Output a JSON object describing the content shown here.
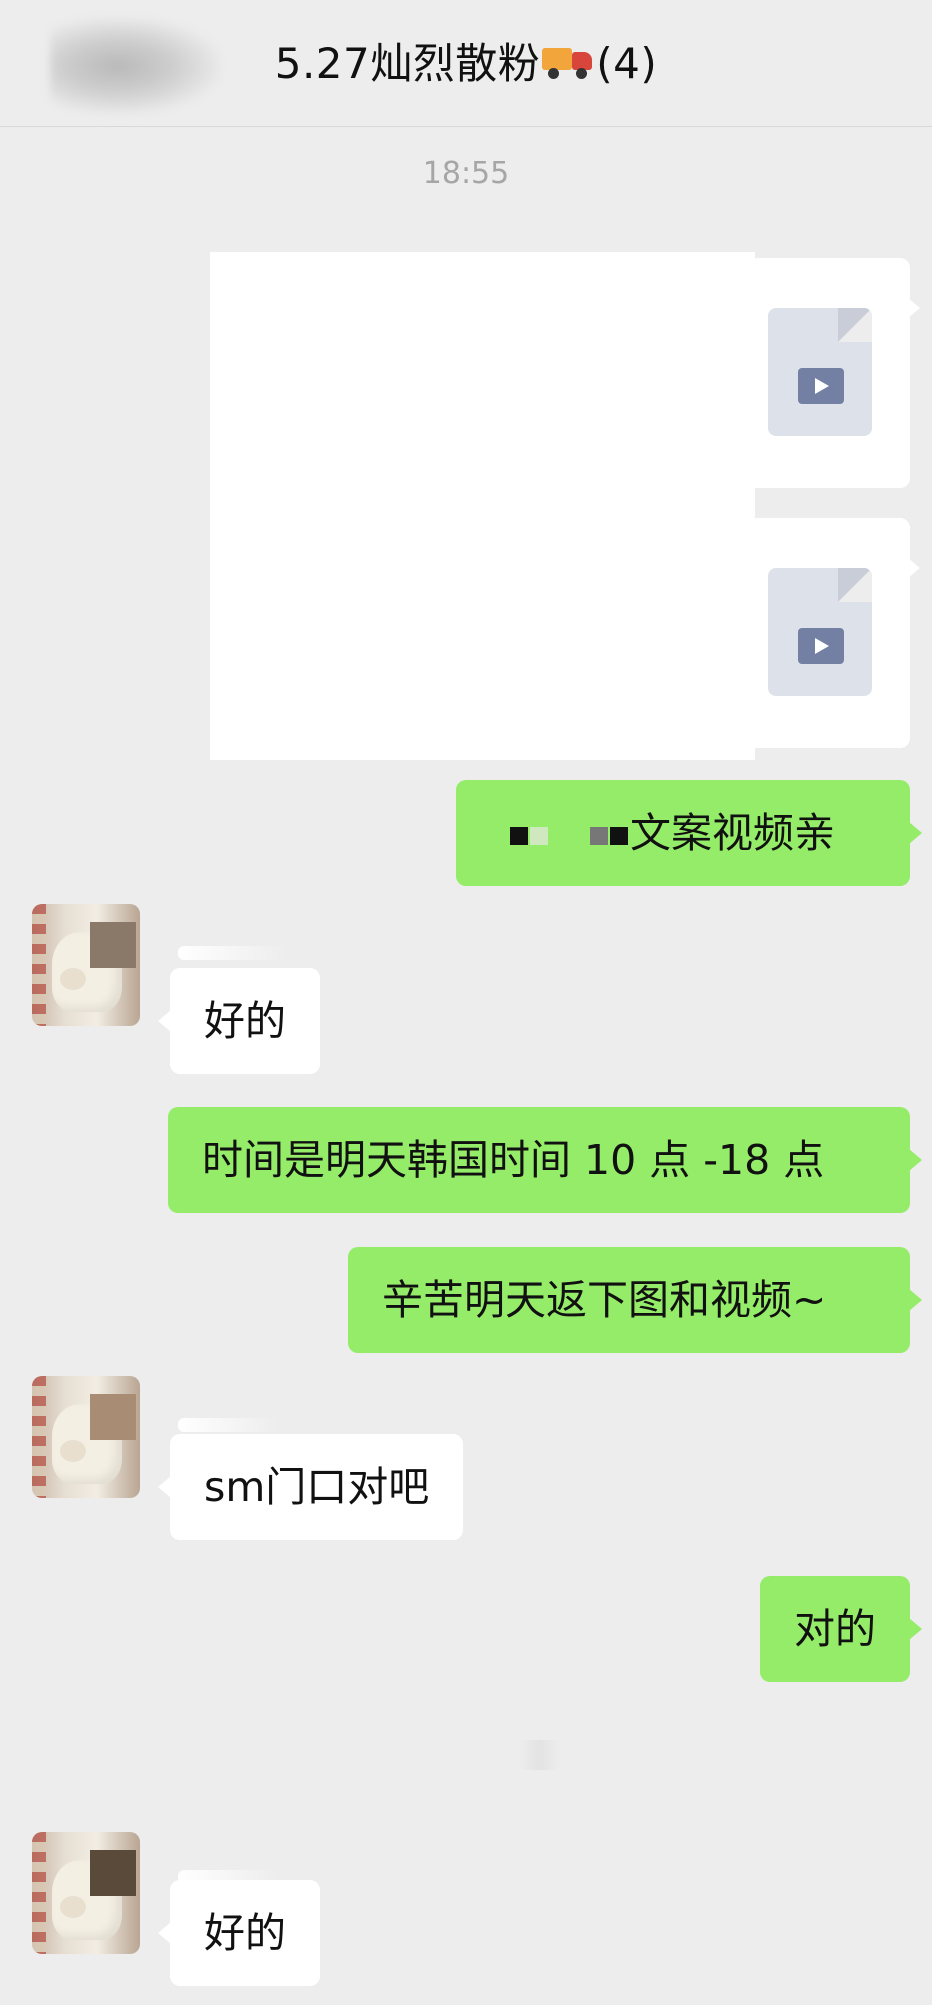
{
  "header": {
    "title_prefix": "5.27灿烈散粉",
    "title_suffix": "(4)",
    "truck_icon": "delivery-truck-emoji"
  },
  "timestamp": "18:55",
  "messages": [
    {
      "from": "me",
      "type": "video-file"
    },
    {
      "from": "me",
      "type": "video-file"
    },
    {
      "from": "me",
      "type": "text",
      "text": "文案视频亲"
    },
    {
      "from": "other",
      "type": "text",
      "text": "好的"
    },
    {
      "from": "me",
      "type": "text",
      "text": "时间是明天韩国时间 10 点 -18 点"
    },
    {
      "from": "me",
      "type": "text",
      "text": "辛苦明天返下图和视频~"
    },
    {
      "from": "other",
      "type": "text",
      "text": "sm门口对吧"
    },
    {
      "from": "me",
      "type": "text",
      "text": "对的"
    },
    {
      "from": "other",
      "type": "text",
      "text": "好的"
    }
  ],
  "colors": {
    "background": "#ededed",
    "my_bubble": "#95ec69",
    "other_bubble": "#ffffff",
    "timestamp": "#a6a6a6"
  }
}
